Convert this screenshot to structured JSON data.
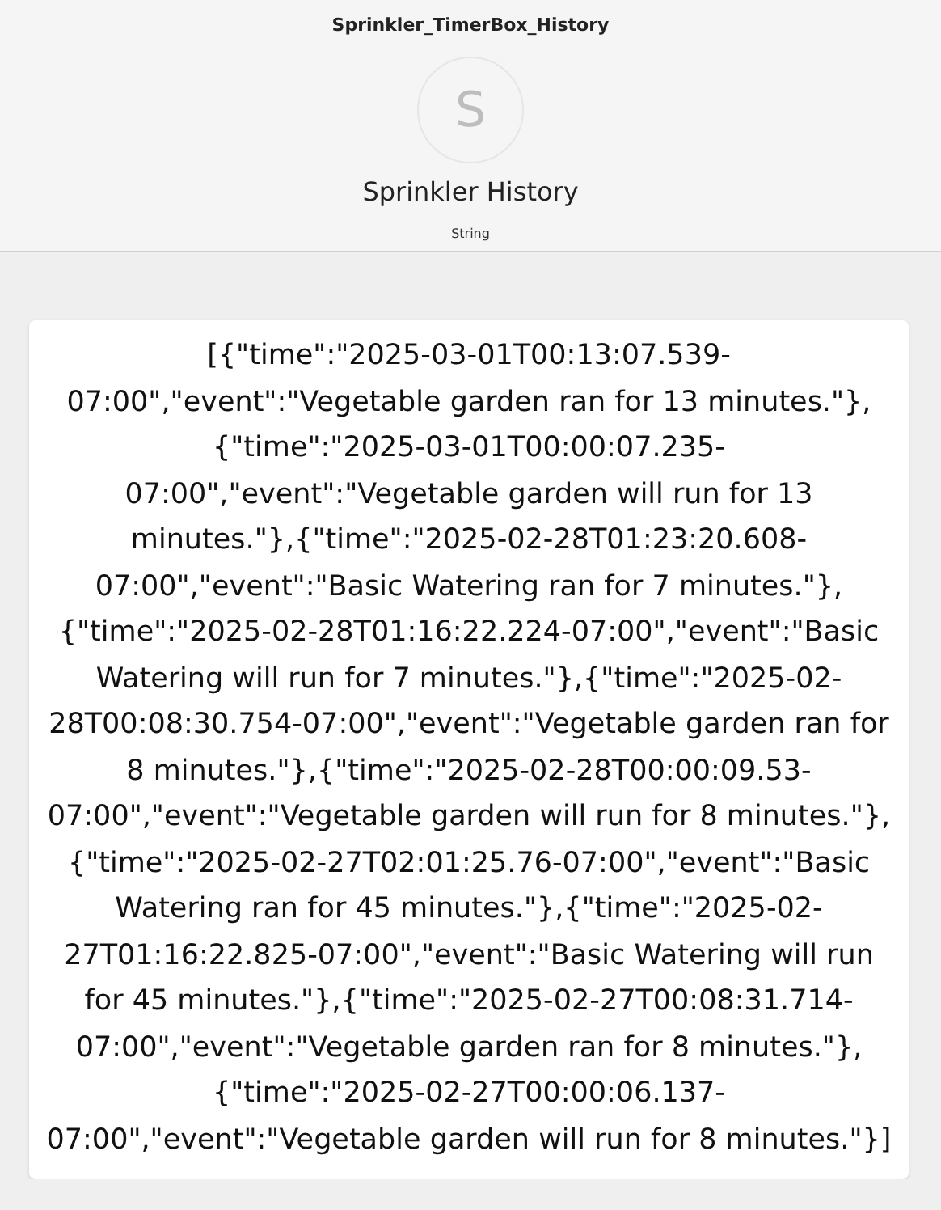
{
  "header": {
    "device_name": "Sprinkler_TimerBox_History",
    "avatar_letter": "S",
    "attribute_label": "Sprinkler History",
    "attribute_type": "String"
  },
  "value": "[{\"time\":\"2025-03-01T00:13:07.539-07:00\",\"event\":\"Vegetable garden ran for 13 minutes.\"},{\"time\":\"2025-03-01T00:00:07.235-07:00\",\"event\":\"Vegetable garden will run for 13 minutes.\"},{\"time\":\"2025-02-28T01:23:20.608-07:00\",\"event\":\"Basic Watering ran for 7 minutes.\"},{\"time\":\"2025-02-28T01:16:22.224-07:00\",\"event\":\"Basic Watering will run for 7 minutes.\"},{\"time\":\"2025-02-28T00:08:30.754-07:00\",\"event\":\"Vegetable garden ran for 8 minutes.\"},{\"time\":\"2025-02-28T00:00:09.53-07:00\",\"event\":\"Vegetable garden will run for 8 minutes.\"},{\"time\":\"2025-02-27T02:01:25.76-07:00\",\"event\":\"Basic Watering ran for 45 minutes.\"},{\"time\":\"2025-02-27T01:16:22.825-07:00\",\"event\":\"Basic Watering will run for 45 minutes.\"},{\"time\":\"2025-02-27T00:08:31.714-07:00\",\"event\":\"Vegetable garden ran for 8 minutes.\"},{\"time\":\"2025-02-27T00:00:06.137-07:00\",\"event\":\"Vegetable garden will run for 8 minutes.\"}]"
}
